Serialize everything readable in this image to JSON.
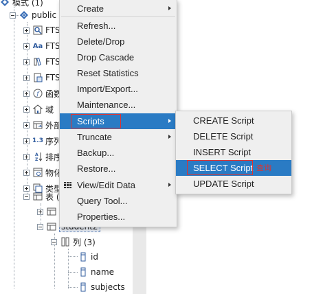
{
  "tree": {
    "top_label": "模式 (1)",
    "schema_label": "public",
    "nodes": [
      {
        "label": "FTS",
        "icon": "fts-configuration-icon"
      },
      {
        "label": "FTS",
        "icon": "fts-dictionary-icon",
        "icon_text": "Aa"
      },
      {
        "label": "FTS",
        "icon": "fts-parser-icon"
      },
      {
        "label": "FTS",
        "icon": "fts-template-icon"
      },
      {
        "label": "函数",
        "icon": "function-icon"
      },
      {
        "label": "域",
        "icon": "domain-icon"
      },
      {
        "label": "外部",
        "icon": "foreign-table-icon"
      },
      {
        "label": "序列",
        "icon": "sequence-icon",
        "icon_text": "1.3"
      },
      {
        "label": "排序",
        "icon": "collation-icon"
      },
      {
        "label": "物化",
        "icon": "materialized-view-icon"
      },
      {
        "label": "类型",
        "icon": "type-icon"
      },
      {
        "label": "表 (",
        "icon": "table-icon"
      }
    ],
    "tables": [
      {
        "label": ""
      },
      {
        "label": "student2"
      }
    ],
    "columns_label": "列 (3)",
    "columns": [
      "id",
      "name",
      "subjects"
    ]
  },
  "context_menu": {
    "items": [
      {
        "label": "Create",
        "submenu": true
      },
      {
        "label": "Refresh..."
      },
      {
        "label": "Delete/Drop"
      },
      {
        "label": "Drop Cascade"
      },
      {
        "label": "Reset Statistics"
      },
      {
        "label": "Import/Export..."
      },
      {
        "label": "Maintenance..."
      },
      {
        "label": "Scripts",
        "submenu": true,
        "active": true
      },
      {
        "label": "Truncate",
        "submenu": true
      },
      {
        "label": "Backup..."
      },
      {
        "label": "Restore..."
      },
      {
        "label": "View/Edit Data",
        "submenu": true,
        "icon": "grid-icon"
      },
      {
        "label": "Query Tool..."
      },
      {
        "label": "Properties..."
      }
    ]
  },
  "scripts_submenu": {
    "items": [
      {
        "label": "CREATE Script"
      },
      {
        "label": "DELETE Script"
      },
      {
        "label": "INSERT Script"
      },
      {
        "label": "SELECT Script",
        "active": true
      },
      {
        "label": "UPDATE Script"
      }
    ],
    "annotation": "查询"
  },
  "colors": {
    "highlight": "#2a7bc4",
    "annotation_red": "#e0332f",
    "menu_bg": "#efefef"
  }
}
